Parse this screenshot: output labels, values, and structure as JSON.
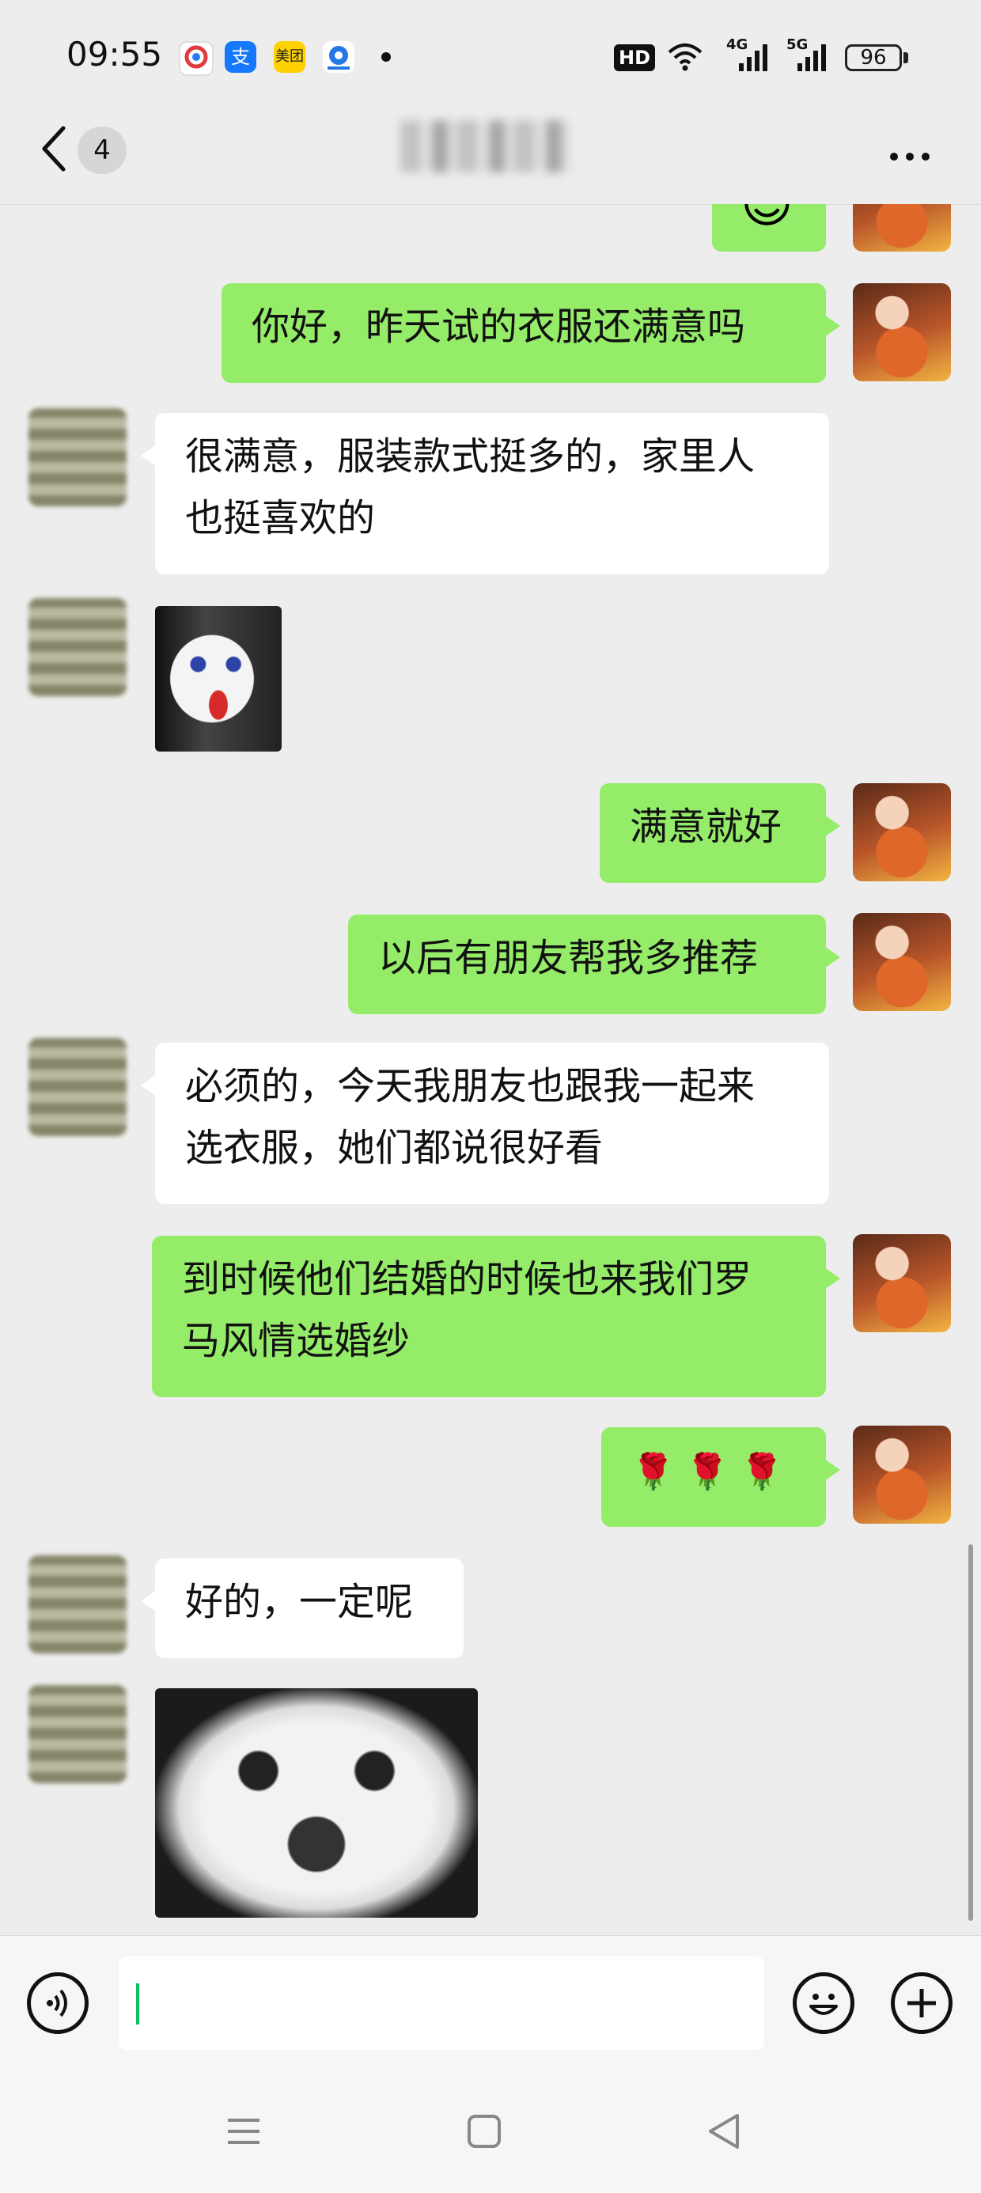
{
  "status_bar": {
    "time": "09:55",
    "apps": [
      {
        "icon": "taobao-app-icon",
        "color": "#ffffff"
      },
      {
        "icon": "alipay-app-icon",
        "label": "支",
        "color": "#1677ff"
      },
      {
        "icon": "meituan-app-icon",
        "label": "美团",
        "color": "#ffd100"
      },
      {
        "icon": "ctrip-app-icon",
        "color": "#2577e3"
      }
    ],
    "hd": "HD",
    "net1": "4G",
    "net2": "5G",
    "battery": "96"
  },
  "header": {
    "unread_count": "4",
    "title": "罗马新娘"
  },
  "messages": [
    {
      "from": "me",
      "type": "emoji",
      "text": "😊"
    },
    {
      "from": "me",
      "type": "text",
      "lines": [
        "你好，昨天试的衣服还满意吗"
      ]
    },
    {
      "from": "other",
      "type": "text",
      "lines": [
        "很满意，服装款式挺多的，家里人",
        "也挺喜欢的"
      ]
    },
    {
      "from": "other",
      "type": "sticker",
      "sticker": "makeup-face-sticker"
    },
    {
      "from": "me",
      "type": "text",
      "lines": [
        "满意就好"
      ]
    },
    {
      "from": "me",
      "type": "text",
      "lines": [
        "以后有朋友帮我多推荐"
      ]
    },
    {
      "from": "other",
      "type": "text",
      "lines": [
        "必须的，今天我朋友也跟我一起来",
        "选衣服，她们都说很好看"
      ]
    },
    {
      "from": "me",
      "type": "text",
      "lines": [
        "到时候他们结婚的时候也来我们罗",
        "马风情选婚纱"
      ]
    },
    {
      "from": "me",
      "type": "text",
      "lines": [
        "🌹 🌹 🌹"
      ]
    },
    {
      "from": "other",
      "type": "text",
      "lines": [
        "好的，一定呢"
      ]
    },
    {
      "from": "other",
      "type": "sticker",
      "sticker": "panda-face-sticker"
    }
  ],
  "colors": {
    "my_bubble": "#95ec69",
    "their_bubble": "#ffffff",
    "background": "#ededed",
    "caret": "#07c160"
  }
}
